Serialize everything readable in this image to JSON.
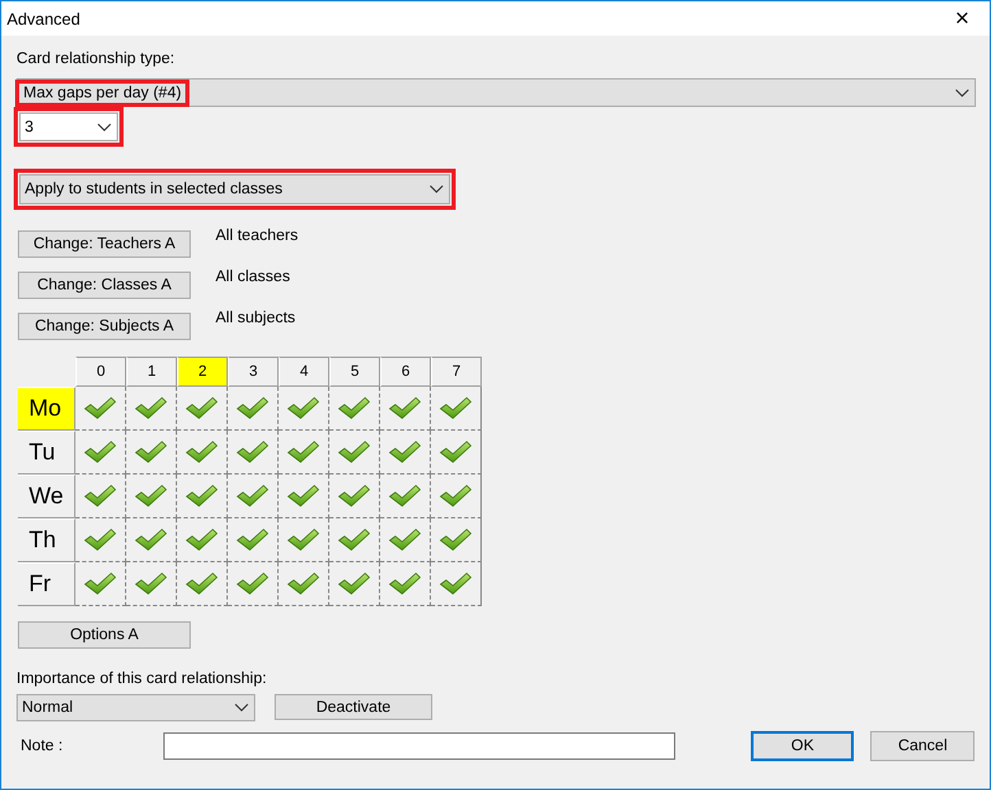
{
  "window": {
    "title": "Advanced",
    "close": "×"
  },
  "relationship_type": {
    "label": "Card relationship type:",
    "value": "Max gaps per day (#4)",
    "highlighted": true
  },
  "count_select": {
    "value": "3",
    "highlighted": true
  },
  "apply_select": {
    "value": "Apply to students in selected classes",
    "highlighted": true
  },
  "filters": [
    {
      "button": "Change: Teachers A",
      "value": "All teachers"
    },
    {
      "button": "Change: Classes A",
      "value": "All classes"
    },
    {
      "button": "Change: Subjects A",
      "value": "All subjects"
    }
  ],
  "grid": {
    "columns": [
      {
        "label": "0",
        "selected": false
      },
      {
        "label": "1",
        "selected": false
      },
      {
        "label": "2",
        "selected": true
      },
      {
        "label": "3",
        "selected": false
      },
      {
        "label": "4",
        "selected": false
      },
      {
        "label": "5",
        "selected": false
      },
      {
        "label": "6",
        "selected": false
      },
      {
        "label": "7",
        "selected": false
      }
    ],
    "rows": [
      {
        "day": "Mo",
        "selected": true,
        "allowed": [
          true,
          true,
          true,
          true,
          true,
          true,
          true,
          true
        ]
      },
      {
        "day": "Tu",
        "selected": false,
        "allowed": [
          true,
          true,
          true,
          true,
          true,
          true,
          true,
          true
        ]
      },
      {
        "day": "We",
        "selected": false,
        "allowed": [
          true,
          true,
          true,
          true,
          true,
          true,
          true,
          true
        ]
      },
      {
        "day": "Th",
        "selected": false,
        "allowed": [
          true,
          true,
          true,
          true,
          true,
          true,
          true,
          true
        ]
      },
      {
        "day": "Fr",
        "selected": false,
        "allowed": [
          true,
          true,
          true,
          true,
          true,
          true,
          true,
          true
        ]
      }
    ]
  },
  "options_button": "Options A",
  "importance": {
    "label": "Importance of this card relationship:",
    "value": "Normal"
  },
  "deactivate_button": "Deactivate",
  "note": {
    "label": "Note :"
  },
  "buttons": [
    {
      "label": "OK",
      "default": true
    },
    {
      "label": "Cancel",
      "default": false
    }
  ]
}
